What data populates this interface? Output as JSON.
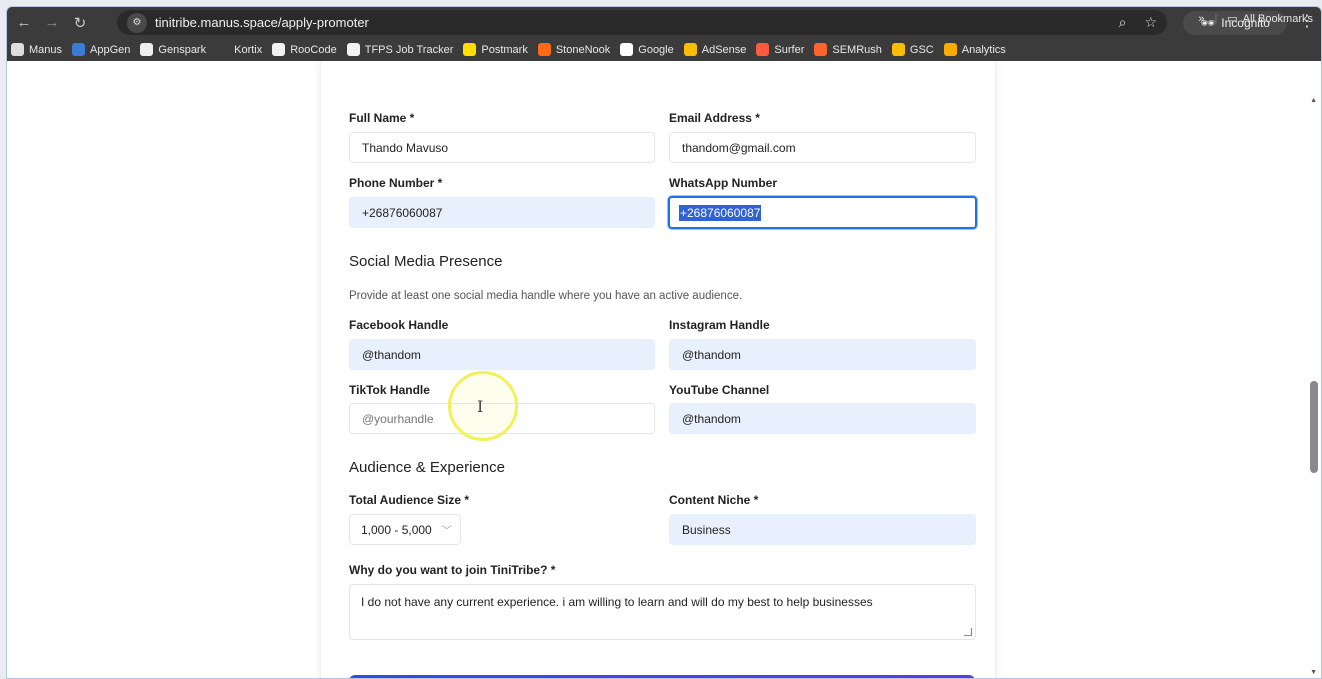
{
  "browser": {
    "url": "tinitribe.manus.space/apply-promoter",
    "incognito_label": "Incognito",
    "bookmarks": [
      {
        "label": "Manus",
        "icon": "manus-icon",
        "color": "#dddddd"
      },
      {
        "label": "AppGen",
        "icon": "appgen-icon",
        "color": "#3a7bd5"
      },
      {
        "label": "Genspark",
        "icon": "genspark-icon",
        "color": "#eeeeee"
      },
      {
        "label": "Kortix",
        "icon": "kortix-icon",
        "color": "#3b3b3b"
      },
      {
        "label": "RooCode",
        "icon": "roocode-icon",
        "color": "#f2f2f2"
      },
      {
        "label": "TFPS Job Tracker",
        "icon": "tracker-icon",
        "color": "#f2f2f2"
      },
      {
        "label": "Postmark",
        "icon": "postmark-icon",
        "color": "#ffde00"
      },
      {
        "label": "StoneNook",
        "icon": "stonenook-icon",
        "color": "#ff6a13"
      },
      {
        "label": "Google",
        "icon": "google-icon",
        "color": "#ffffff"
      },
      {
        "label": "AdSense",
        "icon": "adsense-icon",
        "color": "#fbbc04"
      },
      {
        "label": "Surfer",
        "icon": "surfer-icon",
        "color": "#ff5a3c"
      },
      {
        "label": "SEMRush",
        "icon": "semrush-icon",
        "color": "#ff642d"
      },
      {
        "label": "GSC",
        "icon": "gsc-icon",
        "color": "#fbbc04"
      },
      {
        "label": "Analytics",
        "icon": "analytics-icon",
        "color": "#f9ab00"
      }
    ],
    "more_label": "»",
    "all_bookmarks_label": "All Bookmarks"
  },
  "form": {
    "full_name": {
      "label": "Full Name *",
      "value": "Thando Mavuso"
    },
    "email": {
      "label": "Email Address *",
      "value": "thandom@gmail.com"
    },
    "phone": {
      "label": "Phone Number *",
      "value": "+26876060087"
    },
    "whatsapp": {
      "label": "WhatsApp Number",
      "value": "+26876060087"
    },
    "social_heading": "Social Media Presence",
    "social_helper": "Provide at least one social media handle where you have an active audience.",
    "facebook": {
      "label": "Facebook Handle",
      "value": "@thandom"
    },
    "instagram": {
      "label": "Instagram Handle",
      "value": "@thandom"
    },
    "tiktok": {
      "label": "TikTok Handle",
      "placeholder": "@yourhandle"
    },
    "youtube": {
      "label": "YouTube Channel",
      "value": "@thandom"
    },
    "audience_heading": "Audience & Experience",
    "audience_size": {
      "label": "Total Audience Size *",
      "value": "1,000 - 5,000"
    },
    "niche": {
      "label": "Content Niche *",
      "value": "Business"
    },
    "why": {
      "label": "Why do you want to join TiniTribe? *",
      "value": "I do not have any current experience. i am willing to learn and will do my best to help businesses"
    }
  },
  "colors": {
    "accent": "#1a73e8",
    "autofill": "#e8f0fe",
    "button_start": "#2e4ee0",
    "button_end": "#5a3de8"
  }
}
